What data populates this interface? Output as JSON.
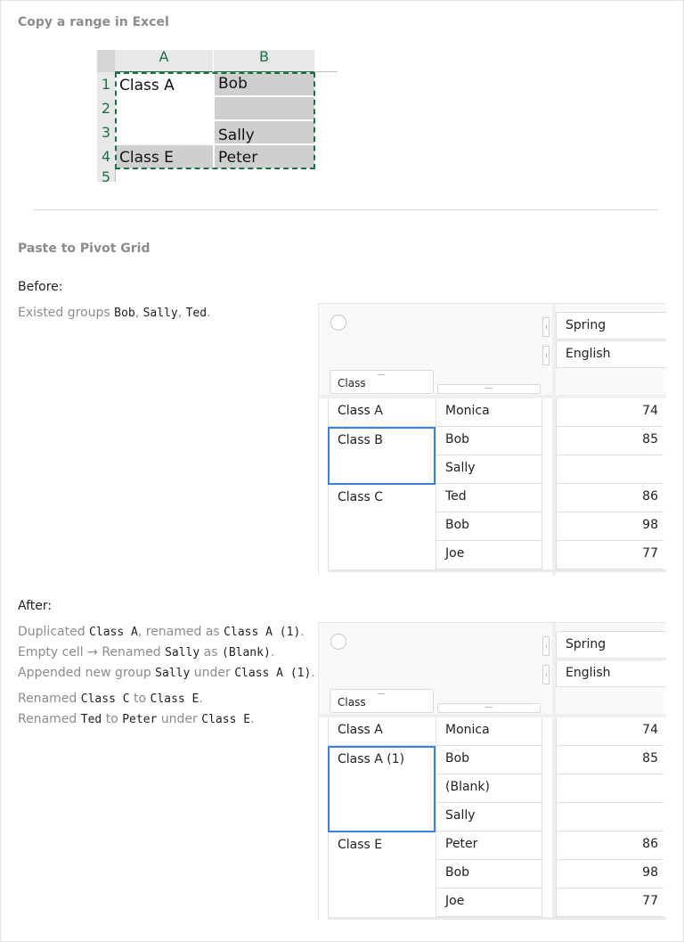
{
  "section1": {
    "title": "Copy a range in Excel"
  },
  "excel": {
    "col_headers": [
      "A",
      "B"
    ],
    "row_headers": [
      "1",
      "2",
      "3",
      "4",
      "5"
    ],
    "cells": {
      "a1": "Class A",
      "b1": "Bob",
      "b2": "",
      "b3": "Sally",
      "a4": "Class E",
      "b4": "Peter"
    },
    "accent_color": "#1e7145"
  },
  "section2": {
    "title": "Paste to Pivot Grid"
  },
  "before": {
    "label": "Before:",
    "desc": {
      "prefix": "Existed groups ",
      "g1": "Bob",
      "sep1": ", ",
      "g2": "Sally",
      "sep2": ", ",
      "g3": "Ted",
      "suffix": "."
    },
    "pivot": {
      "col_header_1": "Spring",
      "col_header_2": "English",
      "row_field": "Class",
      "class_cells": [
        "Class A",
        "Class B",
        "Class C"
      ],
      "name_cells": [
        "Monica",
        "Bob",
        "Sally",
        "Ted",
        "Bob",
        "Joe"
      ],
      "values": [
        "74",
        "85",
        "",
        "86",
        "98",
        "77"
      ]
    }
  },
  "after": {
    "label": "After:",
    "lines": {
      "l1": {
        "t1": "Duplicated ",
        "c1": "Class A",
        "t2": ", renamed as ",
        "c2": "Class A (1)",
        "t3": "."
      },
      "l2": {
        "t1": "Empty cell → Renamed ",
        "c1": "Sally",
        "t2": " as ",
        "c2": "(Blank)",
        "t3": "."
      },
      "l3": {
        "t1": "Appended new group ",
        "c1": "Sally",
        "t2": " under ",
        "c2": "Class A (1)",
        "t3": "."
      },
      "l4": {
        "t1": "Renamed ",
        "c1": "Class C",
        "t2": " to ",
        "c2": "Class E",
        "t3": "."
      },
      "l5": {
        "t1": "Renamed ",
        "c1": "Ted",
        "t2": " to ",
        "c2": "Peter",
        "t3": " under ",
        "c3": "Class E",
        "t4": "."
      }
    },
    "pivot": {
      "col_header_1": "Spring",
      "col_header_2": "English",
      "row_field": "Class",
      "class_cells": [
        "Class A",
        "Class A (1)",
        "Class E"
      ],
      "name_cells": [
        "Monica",
        "Bob",
        "(Blank)",
        "Sally",
        "Peter",
        "Bob",
        "Joe"
      ],
      "values": [
        "74",
        "85",
        "",
        "",
        "86",
        "98",
        "77"
      ]
    }
  },
  "selection_color": "#3b82e0"
}
